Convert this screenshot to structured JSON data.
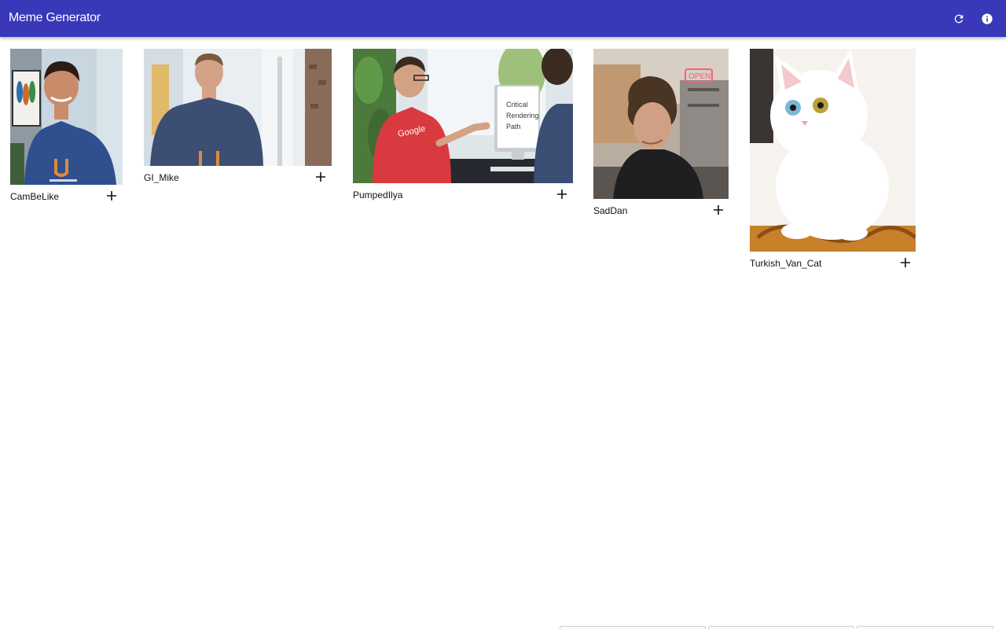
{
  "app": {
    "title": "Meme Generator",
    "accent": "#3838b9",
    "actions": [
      {
        "icon": "refresh-icon"
      },
      {
        "icon": "info-icon"
      }
    ]
  },
  "memes": [
    {
      "name": "CamBeLike",
      "action_icon": "plus-icon"
    },
    {
      "name": "GI_Mike",
      "action_icon": "plus-icon"
    },
    {
      "name": "PumpedIlya",
      "action_icon": "plus-icon",
      "image_text": [
        "Critical",
        "Rendering",
        "Path"
      ],
      "shirt_text": "Google"
    },
    {
      "name": "SadDan",
      "action_icon": "plus-icon",
      "image_text": [
        "OPEN"
      ]
    },
    {
      "name": "Turkish_Van_Cat",
      "action_icon": "plus-icon"
    }
  ]
}
